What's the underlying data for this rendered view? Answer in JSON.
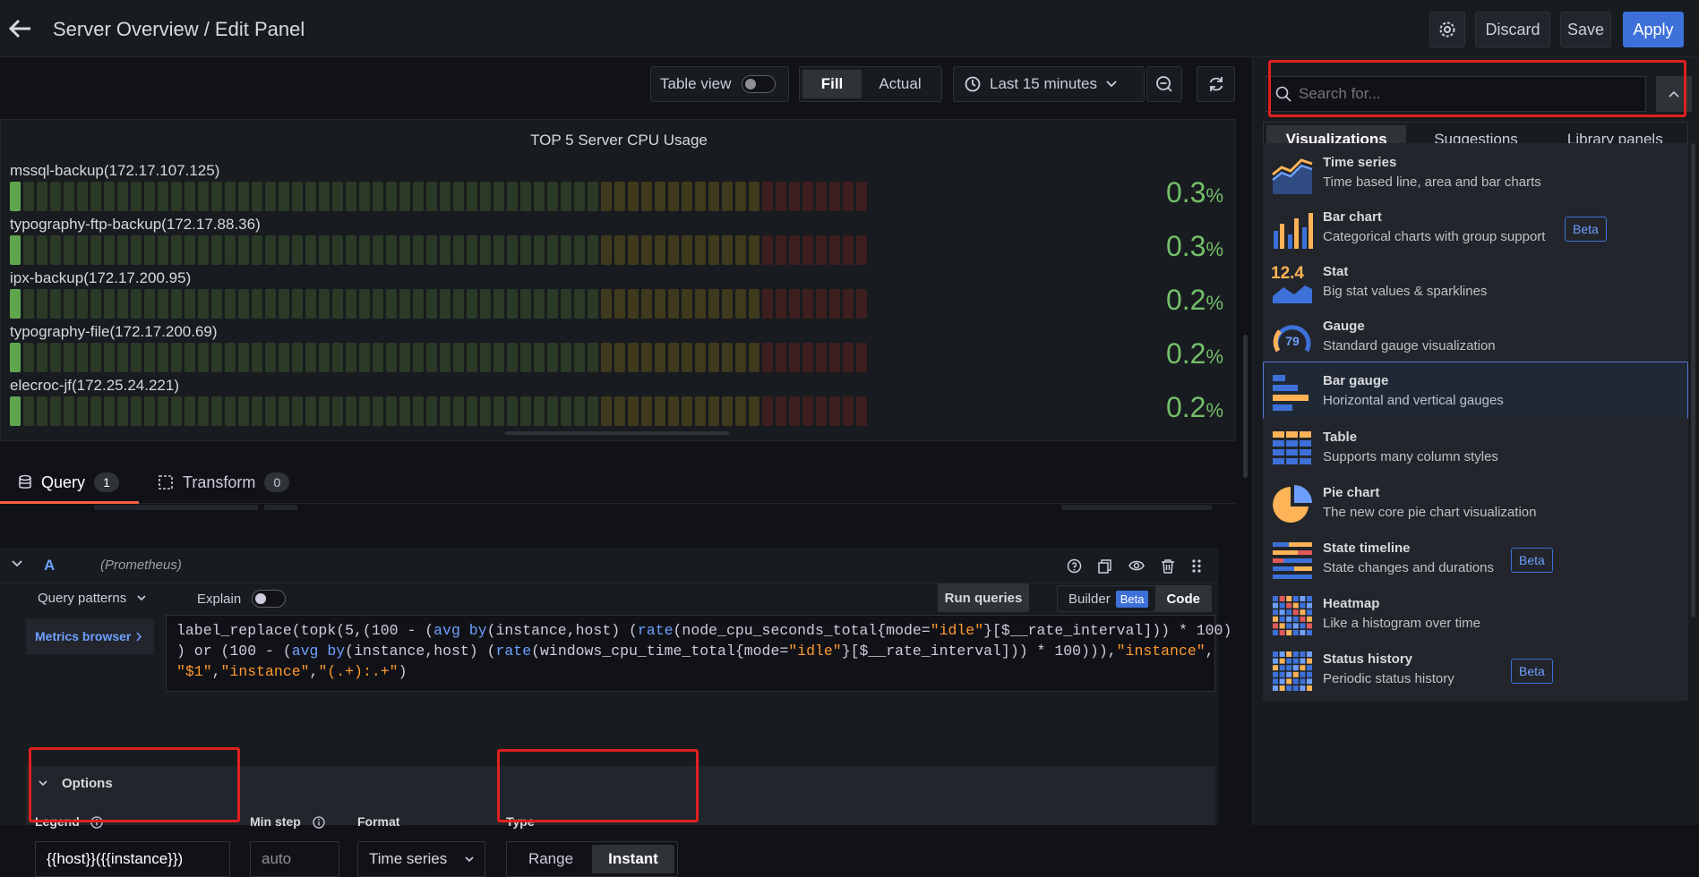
{
  "header": {
    "title": "Server Overview / Edit Panel",
    "discard_label": "Discard",
    "save_label": "Save",
    "apply_label": "Apply"
  },
  "panel_toolbar": {
    "table_view_label": "Table view",
    "fill_label": "Fill",
    "actual_label": "Actual",
    "time_range": "Last 15 minutes"
  },
  "panel": {
    "title": "TOP 5 Server CPU Usage",
    "rows": [
      {
        "label": "mssql-backup(172.17.107.125)",
        "value": "0.3",
        "unit": "%",
        "fraction": 0.003
      },
      {
        "label": "typography-ftp-backup(172.17.88.36)",
        "value": "0.3",
        "unit": "%",
        "fraction": 0.003
      },
      {
        "label": "ipx-backup(172.17.200.95)",
        "value": "0.2",
        "unit": "%",
        "fraction": 0.002
      },
      {
        "label": "typography-file(172.17.200.69)",
        "value": "0.2",
        "unit": "%",
        "fraction": 0.002
      },
      {
        "label": "elecroc-jf(172.25.24.221)",
        "value": "0.2",
        "unit": "%",
        "fraction": 0.002
      }
    ]
  },
  "tabs": {
    "query_label": "Query",
    "query_count": "1",
    "transform_label": "Transform",
    "transform_count": "0"
  },
  "query": {
    "ref_id": "A",
    "datasource": "(Prometheus)",
    "query_patterns_label": "Query patterns",
    "explain_label": "Explain",
    "run_queries_label": "Run queries",
    "builder_label": "Builder",
    "beta_label": "Beta",
    "code_label": "Code",
    "metrics_browser_label": "Metrics browser",
    "options_label": "Options",
    "legend_label": "Legend",
    "legend_value": "{{host}}({{instance}})",
    "min_step_label": "Min step",
    "min_step_placeholder": "auto",
    "format_label": "Format",
    "format_value": "Time series",
    "type_label": "Type",
    "type_range": "Range",
    "type_instant": "Instant"
  },
  "sidebar": {
    "search_placeholder": "Search for...",
    "tab_visualizations": "Visualizations",
    "tab_suggestions": "Suggestions",
    "tab_library": "Library panels",
    "items": [
      {
        "name": "Time series",
        "desc": "Time based line, area and bar charts",
        "beta": ""
      },
      {
        "name": "Bar chart",
        "desc": "Categorical charts with group support",
        "beta": "Beta"
      },
      {
        "name": "Stat",
        "desc": "Big stat values & sparklines",
        "beta": "",
        "icon_text": "12.4"
      },
      {
        "name": "Gauge",
        "desc": "Standard gauge visualization",
        "beta": "",
        "icon_text": "79"
      },
      {
        "name": "Bar gauge",
        "desc": "Horizontal and vertical gauges",
        "beta": ""
      },
      {
        "name": "Table",
        "desc": "Supports many column styles",
        "beta": ""
      },
      {
        "name": "Pie chart",
        "desc": "The new core pie chart visualization",
        "beta": ""
      },
      {
        "name": "State timeline",
        "desc": "State changes and durations",
        "beta": "Beta"
      },
      {
        "name": "Heatmap",
        "desc": "Like a histogram over time",
        "beta": ""
      },
      {
        "name": "Status history",
        "desc": "Periodic status history",
        "beta": "Beta"
      }
    ]
  },
  "colors": {
    "accent": "#3d71d9",
    "gauge_green": "#73bf69",
    "highlight": "#e02020"
  }
}
